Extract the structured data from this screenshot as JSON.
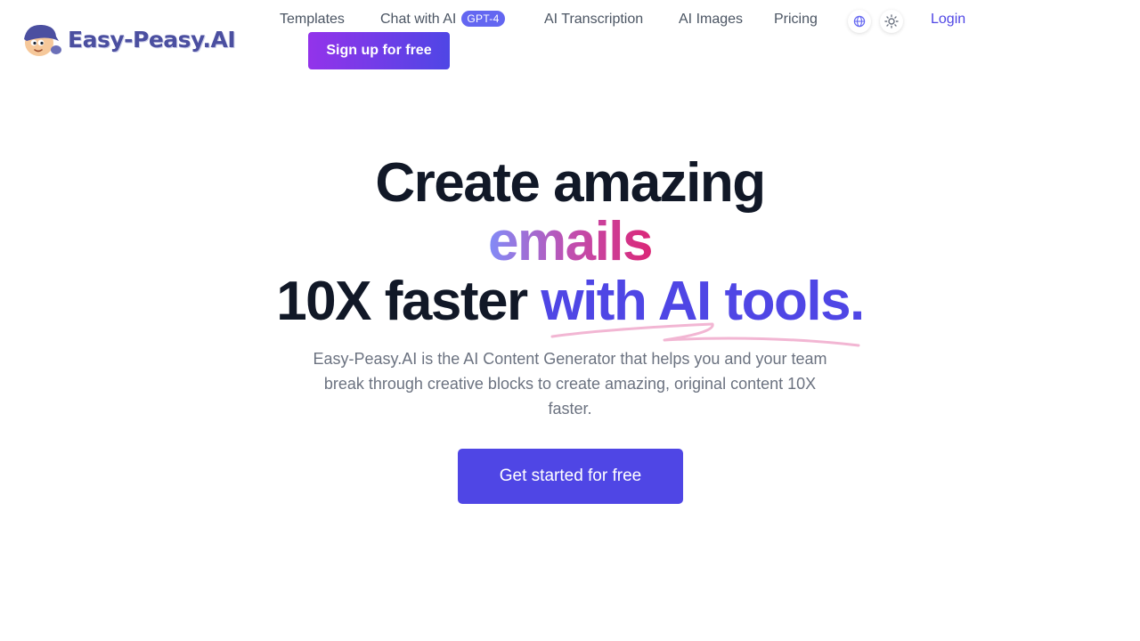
{
  "brand": {
    "name": "Easy-Peasy.AI"
  },
  "nav": {
    "templates": "Templates",
    "chat": "Chat with AI",
    "chat_badge": "GPT-4",
    "transcription": "AI Transcription",
    "images": "AI Images",
    "pricing": "Pricing",
    "language_icon": "globe-icon",
    "theme_icon": "sun-icon",
    "login": "Login",
    "signup": "Sign up for free"
  },
  "hero": {
    "line1": "Create amazing",
    "rotating_word": "emails",
    "line3_plain": "10X faster",
    "line3_accent": "with AI tools.",
    "subtitle": "Easy-Peasy.AI is the AI Content Generator that helps you and your team break through creative blocks to create amazing, original content 10X faster.",
    "cta": "Get started for free"
  },
  "colors": {
    "accent": "#4f46e5",
    "signup_gradient_start": "#9333ea",
    "badge": "#6366f1",
    "scribble": "#f2b6d3",
    "heading": "#111827",
    "muted_text": "#6b7280"
  }
}
